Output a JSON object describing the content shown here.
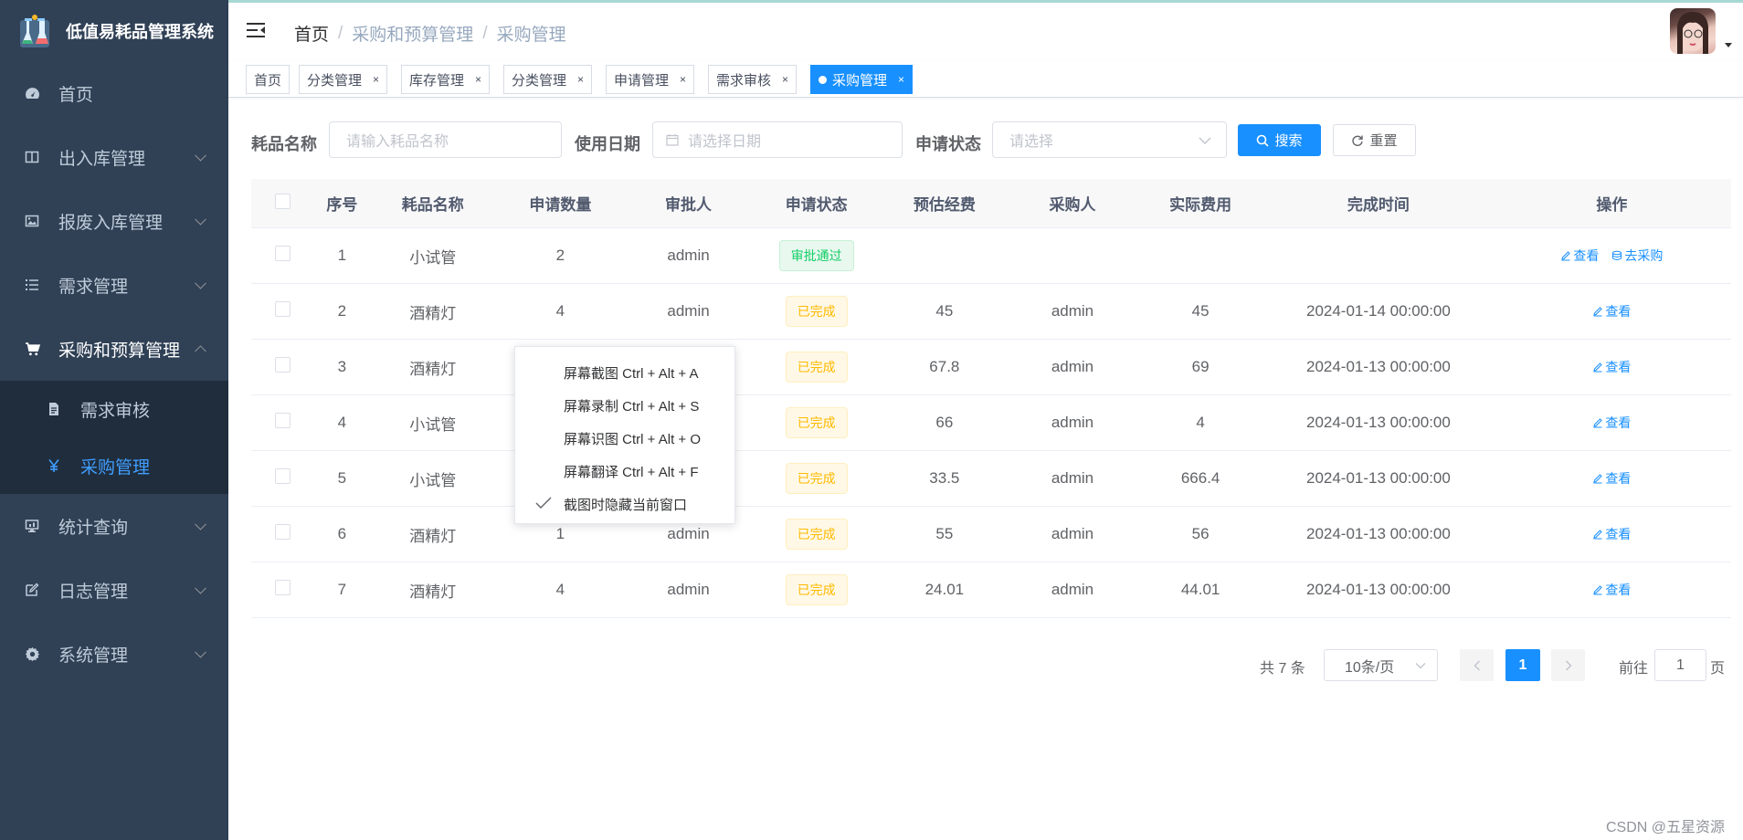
{
  "app": {
    "title": "低值易耗品管理系统"
  },
  "sidebar": {
    "items": [
      {
        "label": "首页",
        "icon": "dashboard-icon"
      },
      {
        "label": "出入库管理",
        "icon": "columns-icon"
      },
      {
        "label": "报废入库管理",
        "icon": "image-icon"
      },
      {
        "label": "需求管理",
        "icon": "list-icon"
      },
      {
        "label": "采购和预算管理",
        "icon": "cart-icon"
      },
      {
        "label": "统计查询",
        "icon": "monitor-icon"
      },
      {
        "label": "日志管理",
        "icon": "edit-icon"
      },
      {
        "label": "系统管理",
        "icon": "gear-icon"
      }
    ],
    "submenu": [
      {
        "label": "需求审核",
        "icon": "document-icon"
      },
      {
        "label": "采购管理",
        "icon": "yen-icon"
      }
    ]
  },
  "breadcrumb": {
    "home": "首页",
    "sep": "/",
    "level1": "采购和预算管理",
    "level2": "采购管理"
  },
  "tags": [
    {
      "label": "首页"
    },
    {
      "label": "分类管理",
      "close": "×"
    },
    {
      "label": "库存管理",
      "close": "×"
    },
    {
      "label": "分类管理",
      "close": "×"
    },
    {
      "label": "申请管理",
      "close": "×"
    },
    {
      "label": "需求审核",
      "close": "×"
    },
    {
      "label": "采购管理",
      "close": "×"
    }
  ],
  "search": {
    "name_label": "耗品名称",
    "name_placeholder": "请输入耗品名称",
    "date_label": "使用日期",
    "date_placeholder": "请选择日期",
    "status_label": "申请状态",
    "status_placeholder": "请选择",
    "search_btn": "搜索",
    "reset_btn": "重置"
  },
  "table": {
    "headers": [
      "序号",
      "耗品名称",
      "申请数量",
      "审批人",
      "申请状态",
      "预估经费",
      "采购人",
      "实际费用",
      "完成时间",
      "操作"
    ],
    "view_label": "查看",
    "purchase_label": "去采购",
    "rows": [
      {
        "idx": "1",
        "name": "小试管",
        "qty": "2",
        "approver": "admin",
        "status": "审批通过",
        "status_type": "success",
        "budget": "",
        "buyer": "",
        "cost": "",
        "time": "",
        "purchase": true
      },
      {
        "idx": "2",
        "name": "酒精灯",
        "qty": "4",
        "approver": "admin",
        "status": "已完成",
        "status_type": "warning",
        "budget": "45",
        "buyer": "admin",
        "cost": "45",
        "time": "2024-01-14 00:00:00",
        "purchase": false
      },
      {
        "idx": "3",
        "name": "酒精灯",
        "qty": "",
        "approver": "",
        "status": "已完成",
        "status_type": "warning",
        "budget": "67.8",
        "buyer": "admin",
        "cost": "69",
        "time": "2024-01-13 00:00:00",
        "purchase": false
      },
      {
        "idx": "4",
        "name": "小试管",
        "qty": "",
        "approver": "",
        "status": "已完成",
        "status_type": "warning",
        "budget": "66",
        "buyer": "admin",
        "cost": "4",
        "time": "2024-01-13 00:00:00",
        "purchase": false
      },
      {
        "idx": "5",
        "name": "小试管",
        "qty": "",
        "approver": "",
        "status": "已完成",
        "status_type": "warning",
        "budget": "33.5",
        "buyer": "admin",
        "cost": "666.4",
        "time": "2024-01-13 00:00:00",
        "purchase": false
      },
      {
        "idx": "6",
        "name": "酒精灯",
        "qty": "1",
        "approver": "admin",
        "status": "已完成",
        "status_type": "warning",
        "budget": "55",
        "buyer": "admin",
        "cost": "56",
        "time": "2024-01-13 00:00:00",
        "purchase": false
      },
      {
        "idx": "7",
        "name": "酒精灯",
        "qty": "4",
        "approver": "admin",
        "status": "已完成",
        "status_type": "warning",
        "budget": "24.01",
        "buyer": "admin",
        "cost": "44.01",
        "time": "2024-01-13 00:00:00",
        "purchase": false
      }
    ]
  },
  "context_menu": {
    "items": [
      {
        "label": "屏幕截图 Ctrl + Alt + A",
        "checked": false
      },
      {
        "label": "屏幕录制 Ctrl + Alt + S",
        "checked": false
      },
      {
        "label": "屏幕识图 Ctrl + Alt + O",
        "checked": false
      },
      {
        "label": "屏幕翻译 Ctrl + Alt + F",
        "checked": false
      },
      {
        "label": "截图时隐藏当前窗口",
        "checked": true
      }
    ]
  },
  "pagination": {
    "total": "共 7 条",
    "page_size": "10条/页",
    "current": "1",
    "goto_prefix": "前往",
    "goto_value": "1",
    "goto_suffix": "页"
  },
  "watermark": "CSDN @五星资源",
  "colors": {
    "sidebar": "#304156",
    "submenu": "#1f2d3d",
    "primary": "#1890ff",
    "success": "#13ce66",
    "warning": "#ffba00"
  }
}
